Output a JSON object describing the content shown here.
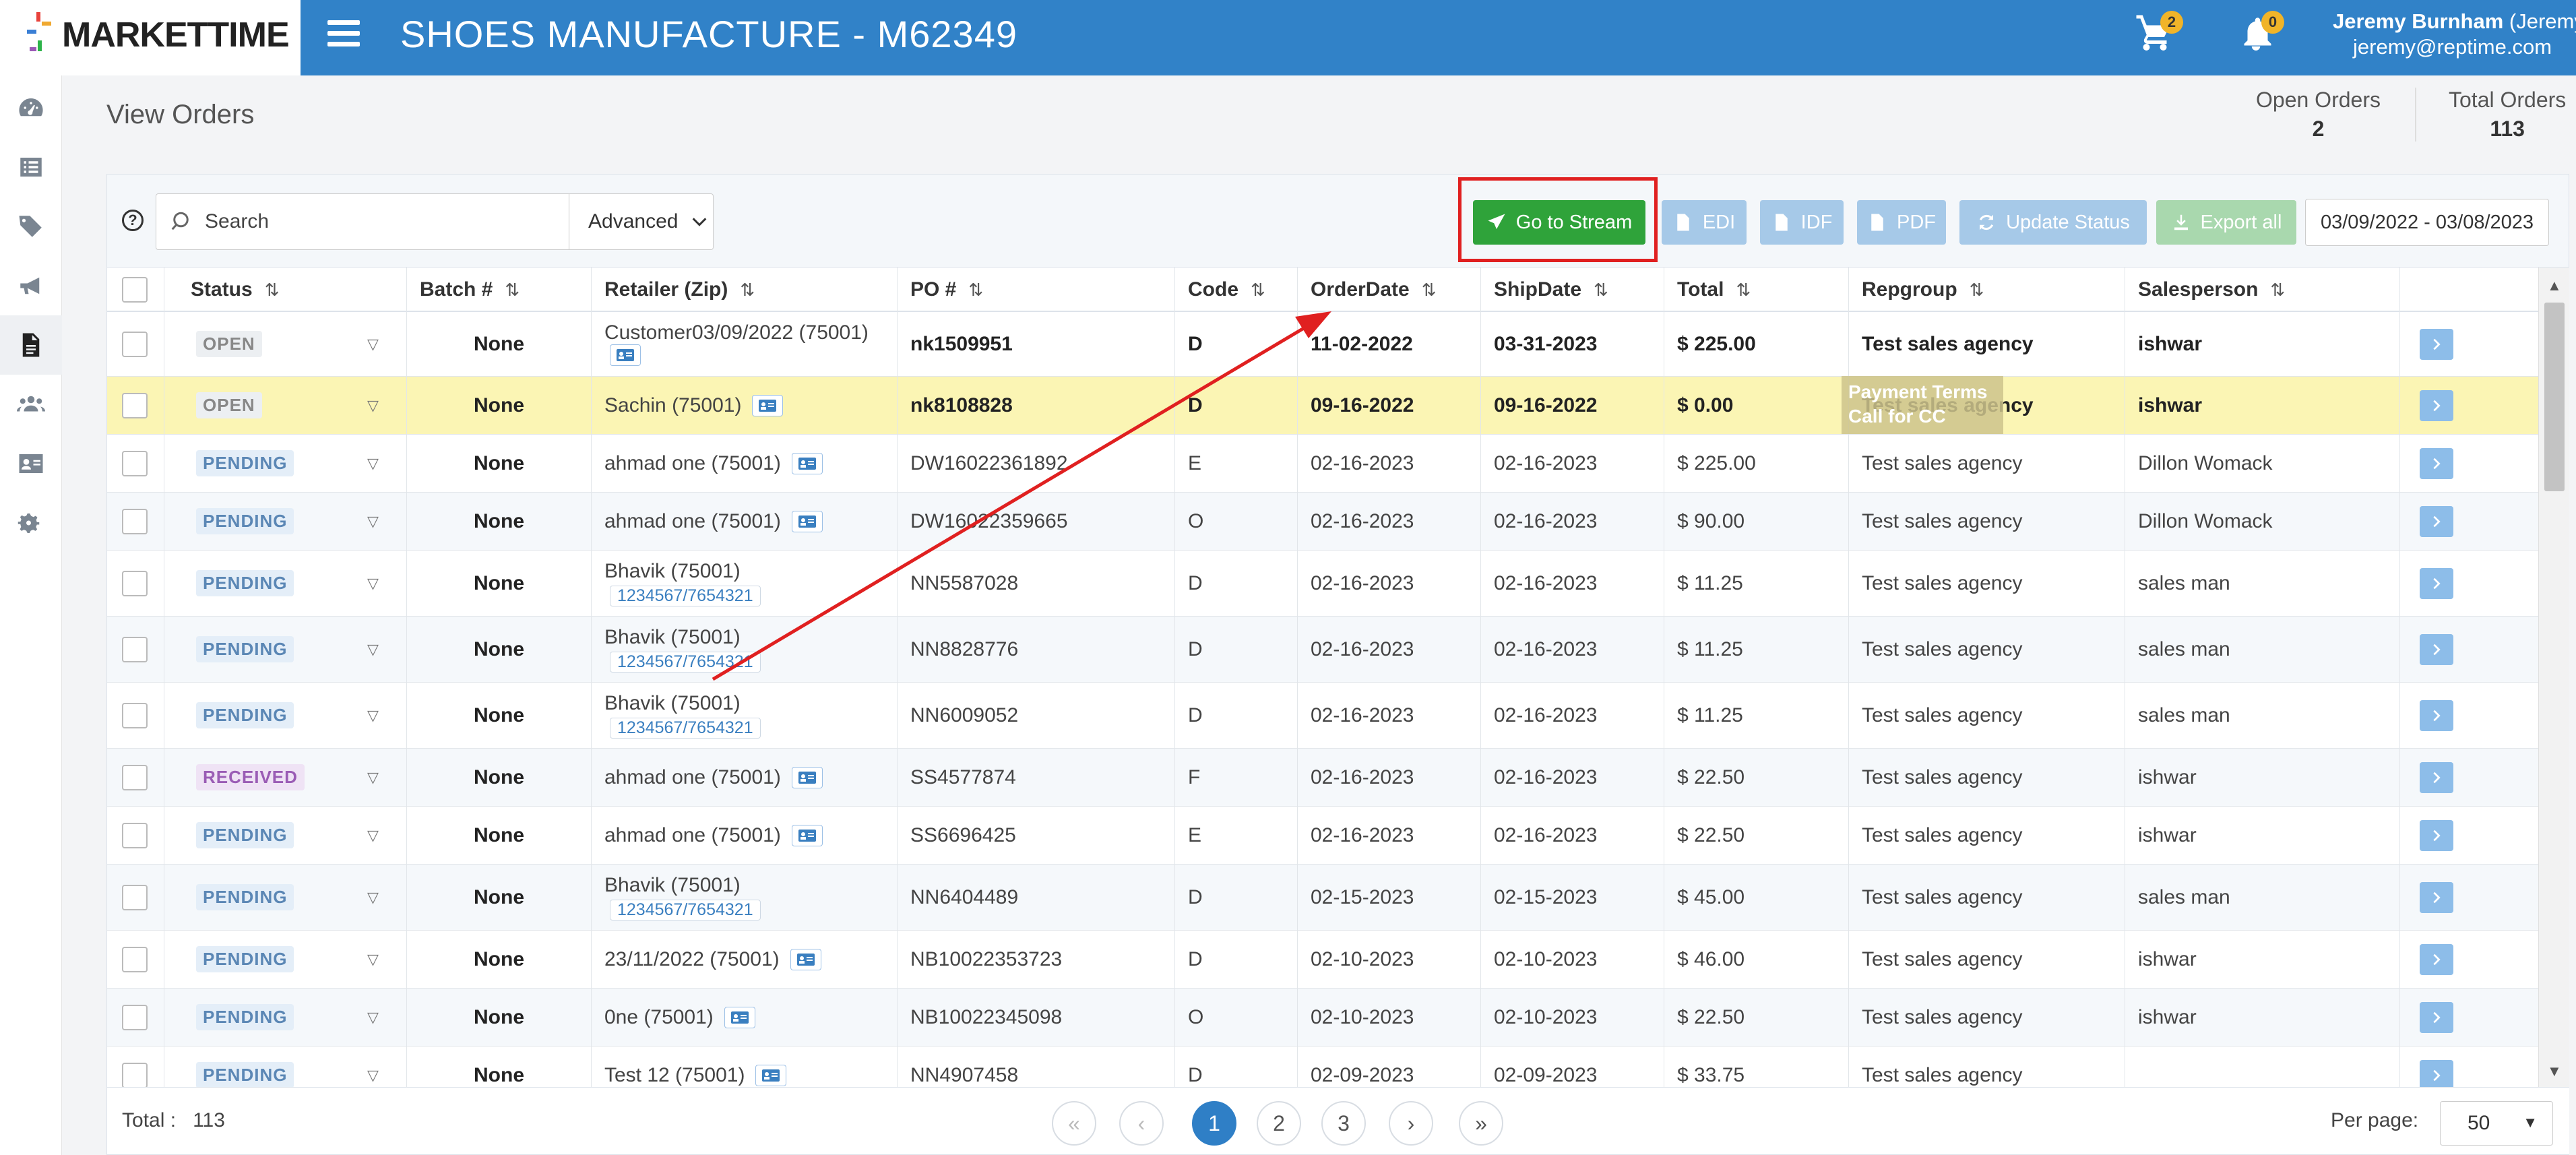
{
  "header": {
    "logo_text": "MARKETTIME",
    "app_title": "SHOES MANUFACTURE - M62349",
    "cart_count": "2",
    "notif_count": "0",
    "user_name": "Jeremy Burnham",
    "user_alias": " (Jeremy)",
    "user_email": "jeremy@reptime.com"
  },
  "sidebar": {
    "items": [
      {
        "name": "dashboard-icon"
      },
      {
        "name": "list-icon"
      },
      {
        "name": "tags-icon"
      },
      {
        "name": "megaphone-icon"
      },
      {
        "name": "document-icon",
        "active": true
      },
      {
        "name": "users-icon"
      },
      {
        "name": "contact-card-icon"
      },
      {
        "name": "settings-gears-icon"
      }
    ]
  },
  "page": {
    "title": "View Orders",
    "open_orders_label": "Open Orders",
    "open_orders_value": "2",
    "total_orders_label": "Total Orders",
    "total_orders_value": "113"
  },
  "toolbar": {
    "search_placeholder": "Search",
    "advanced_label": "Advanced",
    "go_to_stream_label": "Go to Stream",
    "edi_label": "EDI",
    "idf_label": "IDF",
    "pdf_label": "PDF",
    "update_status_label": "Update Status",
    "export_all_label": "Export all",
    "date_range": "03/09/2022 - 03/08/2023"
  },
  "table": {
    "columns": [
      "Status",
      "Batch #",
      "Retailer (Zip)",
      "PO #",
      "Code",
      "OrderDate",
      "ShipDate",
      "Total",
      "Repgroup",
      "Salesperson"
    ],
    "rows": [
      {
        "status": "OPEN",
        "batch": "None",
        "retailer": "Customer03/09/2022 (75001)",
        "phone": "",
        "card": true,
        "card_below": true,
        "po": "nk1509951",
        "code": "D",
        "order_date": "11-02-2022",
        "ship_date": "03-31-2023",
        "total": "$ 225.00",
        "repgroup": "Test sales agency",
        "salesperson": "ishwar",
        "bold": true
      },
      {
        "status": "OPEN",
        "batch": "None",
        "retailer": "Sachin (75001)",
        "phone": "",
        "card": true,
        "card_below": false,
        "po": "nk8108828",
        "code": "D",
        "order_date": "09-16-2022",
        "ship_date": "09-16-2022",
        "total": "$ 0.00",
        "repgroup": "Test sales agency",
        "salesperson": "ishwar",
        "bold": true,
        "highlight": true
      },
      {
        "status": "PENDING",
        "batch": "None",
        "retailer": "ahmad one (75001)",
        "phone": "",
        "card": true,
        "card_below": false,
        "po": "DW16022361892",
        "code": "E",
        "order_date": "02-16-2023",
        "ship_date": "02-16-2023",
        "total": "$ 225.00",
        "repgroup": "Test sales agency",
        "salesperson": "Dillon Womack"
      },
      {
        "status": "PENDING",
        "batch": "None",
        "retailer": "ahmad one (75001)",
        "phone": "",
        "card": true,
        "card_below": false,
        "po": "DW16022359665",
        "code": "O",
        "order_date": "02-16-2023",
        "ship_date": "02-16-2023",
        "total": "$ 90.00",
        "repgroup": "Test sales agency",
        "salesperson": "Dillon Womack"
      },
      {
        "status": "PENDING",
        "batch": "None",
        "retailer": "Bhavik (75001)",
        "phone": "1234567/7654321",
        "card": false,
        "card_below": false,
        "po": "NN5587028",
        "code": "D",
        "order_date": "02-16-2023",
        "ship_date": "02-16-2023",
        "total": "$ 11.25",
        "repgroup": "Test sales agency",
        "salesperson": "sales man"
      },
      {
        "status": "PENDING",
        "batch": "None",
        "retailer": "Bhavik (75001)",
        "phone": "1234567/7654321",
        "card": false,
        "card_below": false,
        "po": "NN8828776",
        "code": "D",
        "order_date": "02-16-2023",
        "ship_date": "02-16-2023",
        "total": "$ 11.25",
        "repgroup": "Test sales agency",
        "salesperson": "sales man"
      },
      {
        "status": "PENDING",
        "batch": "None",
        "retailer": "Bhavik (75001)",
        "phone": "1234567/7654321",
        "card": false,
        "card_below": false,
        "po": "NN6009052",
        "code": "D",
        "order_date": "02-16-2023",
        "ship_date": "02-16-2023",
        "total": "$ 11.25",
        "repgroup": "Test sales agency",
        "salesperson": "sales man"
      },
      {
        "status": "RECEIVED",
        "batch": "None",
        "retailer": "ahmad one (75001)",
        "phone": "",
        "card": true,
        "card_below": false,
        "po": "SS4577874",
        "code": "F",
        "order_date": "02-16-2023",
        "ship_date": "02-16-2023",
        "total": "$ 22.50",
        "repgroup": "Test sales agency",
        "salesperson": "ishwar"
      },
      {
        "status": "PENDING",
        "batch": "None",
        "retailer": "ahmad one (75001)",
        "phone": "",
        "card": true,
        "card_below": false,
        "po": "SS6696425",
        "code": "E",
        "order_date": "02-16-2023",
        "ship_date": "02-16-2023",
        "total": "$ 22.50",
        "repgroup": "Test sales agency",
        "salesperson": "ishwar"
      },
      {
        "status": "PENDING",
        "batch": "None",
        "retailer": "Bhavik (75001)",
        "phone": "1234567/7654321",
        "card": false,
        "card_below": false,
        "po": "NN6404489",
        "code": "D",
        "order_date": "02-15-2023",
        "ship_date": "02-15-2023",
        "total": "$ 45.00",
        "repgroup": "Test sales agency",
        "salesperson": "sales man"
      },
      {
        "status": "PENDING",
        "batch": "None",
        "retailer": "23/11/2022 (75001)",
        "phone": "",
        "card": true,
        "card_below": false,
        "po": "NB10022353723",
        "code": "D",
        "order_date": "02-10-2023",
        "ship_date": "02-10-2023",
        "total": "$ 46.00",
        "repgroup": "Test sales agency",
        "salesperson": "ishwar"
      },
      {
        "status": "PENDING",
        "batch": "None",
        "retailer": "0ne (75001)",
        "phone": "",
        "card": true,
        "card_below": false,
        "po": "NB10022345098",
        "code": "O",
        "order_date": "02-10-2023",
        "ship_date": "02-10-2023",
        "total": "$ 22.50",
        "repgroup": "Test sales agency",
        "salesperson": "ishwar"
      },
      {
        "status": "PENDING",
        "batch": "None",
        "retailer": "Test 12 (75001)",
        "phone": "",
        "card": true,
        "card_below": false,
        "po": "NN4907458",
        "code": "D",
        "order_date": "02-09-2023",
        "ship_date": "02-09-2023",
        "total": "$ 33.75",
        "repgroup": "Test sales agency",
        "salesperson": ""
      }
    ]
  },
  "tooltip": {
    "line1": "Payment Terms",
    "line2": "Call for CC"
  },
  "footer": {
    "total_label": "Total :",
    "total_value": "113",
    "pages": [
      "1",
      "2",
      "3"
    ],
    "current_page": "1",
    "per_page_label": "Per page:",
    "per_page_value": "50"
  },
  "colors": {
    "brand_blue": "#3182c8",
    "go_stream_green": "#2fa33a",
    "highlight_row": "#fbf5b4",
    "annotation_red": "#e02020"
  }
}
